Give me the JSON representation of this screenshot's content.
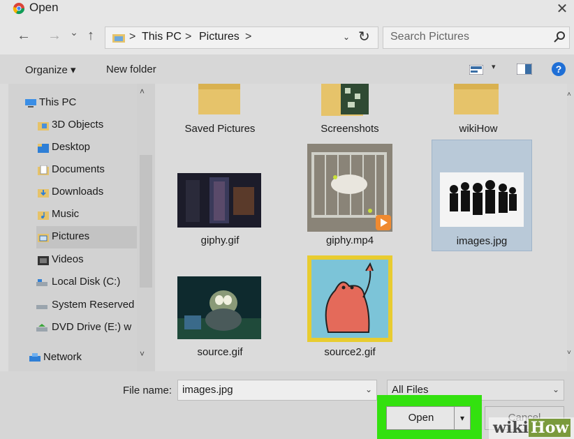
{
  "window": {
    "title": "Open",
    "close_glyph": "✕",
    "app_icon": "chrome-icon"
  },
  "address_bar": {
    "back_glyph": "←",
    "forward_glyph": "→",
    "recent_glyph": "⌄",
    "up_glyph": "↑",
    "crumbs": [
      "This PC",
      "Pictures"
    ],
    "separator": ">",
    "dropdown_glyph": "⌄",
    "refresh_glyph": "↻"
  },
  "search": {
    "placeholder": "Search Pictures",
    "icon": "search-icon"
  },
  "toolbar": {
    "organize_label": "Organize ▾",
    "new_folder_label": "New folder",
    "view_dropdown_glyph": "▾",
    "help_glyph": "?"
  },
  "nav": {
    "items": [
      {
        "label": "This PC",
        "icon": "computer-icon"
      },
      {
        "label": "3D Objects",
        "icon": "3d-objects-icon"
      },
      {
        "label": "Desktop",
        "icon": "desktop-icon"
      },
      {
        "label": "Documents",
        "icon": "documents-icon"
      },
      {
        "label": "Downloads",
        "icon": "downloads-icon"
      },
      {
        "label": "Music",
        "icon": "music-icon"
      },
      {
        "label": "Pictures",
        "icon": "pictures-icon",
        "selected": true
      },
      {
        "label": "Videos",
        "icon": "videos-icon"
      },
      {
        "label": "Local Disk (C:)",
        "icon": "local-disk-icon"
      },
      {
        "label": "System Reserved",
        "icon": "drive-icon"
      },
      {
        "label": "DVD Drive (E:) w",
        "icon": "dvd-drive-icon"
      },
      {
        "label": "Network",
        "icon": "network-icon"
      }
    ],
    "scroll_up_glyph": "˄",
    "scroll_down_glyph": "˅"
  },
  "files": [
    {
      "name": "Saved Pictures",
      "type": "folder"
    },
    {
      "name": "Screenshots",
      "type": "folder"
    },
    {
      "name": "wikiHow",
      "type": "folder"
    },
    {
      "name": "giphy.gif",
      "type": "image"
    },
    {
      "name": "giphy.mp4",
      "type": "video"
    },
    {
      "name": "images.jpg",
      "type": "image",
      "selected": true
    },
    {
      "name": "source.gif",
      "type": "image"
    },
    {
      "name": "source2.gif",
      "type": "image"
    }
  ],
  "bottom": {
    "file_name_label": "File name:",
    "file_name_value": "images.jpg",
    "file_type_value": "All Files",
    "dropdown_glyph": "⌄",
    "open_label": "Open",
    "open_split_glyph": "▾",
    "cancel_label": "Cancel"
  },
  "watermark": {
    "part1": "wiki",
    "part2": "How"
  },
  "colors": {
    "highlight": "#33e10f",
    "selection": "#b9c9d8",
    "folder": "#e6c36a"
  }
}
